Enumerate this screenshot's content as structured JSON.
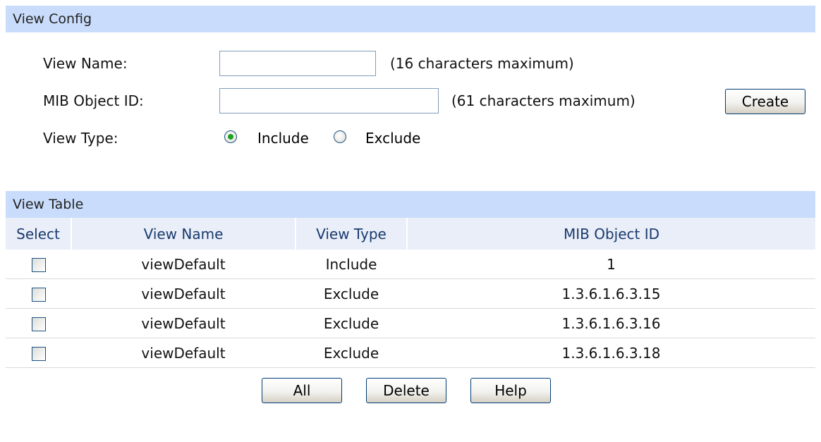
{
  "view_config": {
    "header": "View Config",
    "view_name_label": "View Name:",
    "view_name_value": "",
    "view_name_hint": "(16 characters maximum)",
    "mib_label": "MIB Object ID:",
    "mib_value": "",
    "mib_hint": "(61 characters maximum)",
    "create_label": "Create",
    "view_type_label": "View Type:",
    "view_type_options": [
      "Include",
      "Exclude"
    ],
    "view_type_selected": "Include"
  },
  "view_table": {
    "header": "View Table",
    "columns": [
      "Select",
      "View Name",
      "View Type",
      "MIB Object ID"
    ],
    "rows": [
      {
        "view_name": "viewDefault",
        "view_type": "Include",
        "mib_object_id": "1"
      },
      {
        "view_name": "viewDefault",
        "view_type": "Exclude",
        "mib_object_id": "1.3.6.1.6.3.15"
      },
      {
        "view_name": "viewDefault",
        "view_type": "Exclude",
        "mib_object_id": "1.3.6.1.6.3.16"
      },
      {
        "view_name": "viewDefault",
        "view_type": "Exclude",
        "mib_object_id": "1.3.6.1.6.3.18"
      }
    ]
  },
  "buttons": {
    "all_label": "All",
    "delete_label": "Delete",
    "help_label": "Help"
  },
  "colors": {
    "section_header_bg": "#c9dcfb",
    "table_header_bg": "#e9eef8",
    "radio_selected": "#21a121"
  }
}
